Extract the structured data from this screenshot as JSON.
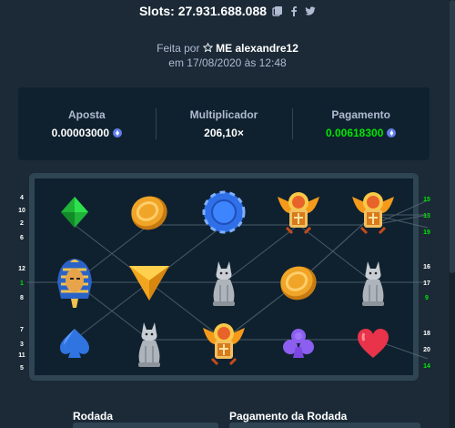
{
  "header": {
    "title": "Slots: 27.931.688.088",
    "icons": [
      "copy-icon",
      "facebook-icon",
      "twitter-icon"
    ]
  },
  "made_by": {
    "prefix": "Feita por",
    "user": "ME alexandre12",
    "date_line": "em 17/08/2020 às 12:48"
  },
  "stats": {
    "bet_label": "Aposta",
    "bet_value": "0.00003000",
    "multiplier_label": "Multiplicador",
    "multiplier_value": "206,10×",
    "payout_label": "Pagamento",
    "payout_value": "0.00618300"
  },
  "reels": [
    [
      "diamond-green",
      "pharaoh",
      "spade-blue"
    ],
    [
      "coin-gold",
      "triangle-gold",
      "cat-statue"
    ],
    [
      "chip-blue",
      "cat-statue",
      "scarab"
    ],
    [
      "scarab",
      "coin-gold",
      "club-purple"
    ],
    [
      "scarab",
      "cat-statue",
      "heart-red"
    ]
  ],
  "left_line_numbers": {
    "row1": [
      {
        "n": "4",
        "win": false
      },
      {
        "n": "10",
        "win": false
      },
      {
        "n": "2",
        "win": false
      },
      {
        "n": "6",
        "win": false
      }
    ],
    "row2": [
      {
        "n": "12",
        "win": false
      },
      {
        "n": "1",
        "win": true
      },
      {
        "n": "8",
        "win": false
      }
    ],
    "row3": [
      {
        "n": "7",
        "win": false
      },
      {
        "n": "3",
        "win": false
      },
      {
        "n": "11",
        "win": false
      },
      {
        "n": "5",
        "win": false
      }
    ]
  },
  "right_line_numbers": {
    "row1": [
      {
        "n": "15",
        "win": true
      },
      {
        "n": "13",
        "win": true
      },
      {
        "n": "19",
        "win": true
      }
    ],
    "row2": [
      {
        "n": "16",
        "win": false
      },
      {
        "n": "17",
        "win": false
      },
      {
        "n": "9",
        "win": true
      }
    ],
    "row3": [
      {
        "n": "18",
        "win": false
      },
      {
        "n": "20",
        "win": false
      },
      {
        "n": "14",
        "win": true
      }
    ]
  },
  "bottom": {
    "round_label": "Rodada",
    "round_payout_label": "Pagamento da Rodada"
  },
  "colors": {
    "background": "#1b2a36",
    "panel": "#0f212e",
    "border": "#2f4553",
    "win_green": "#00e701",
    "muted": "#b1bad3"
  }
}
